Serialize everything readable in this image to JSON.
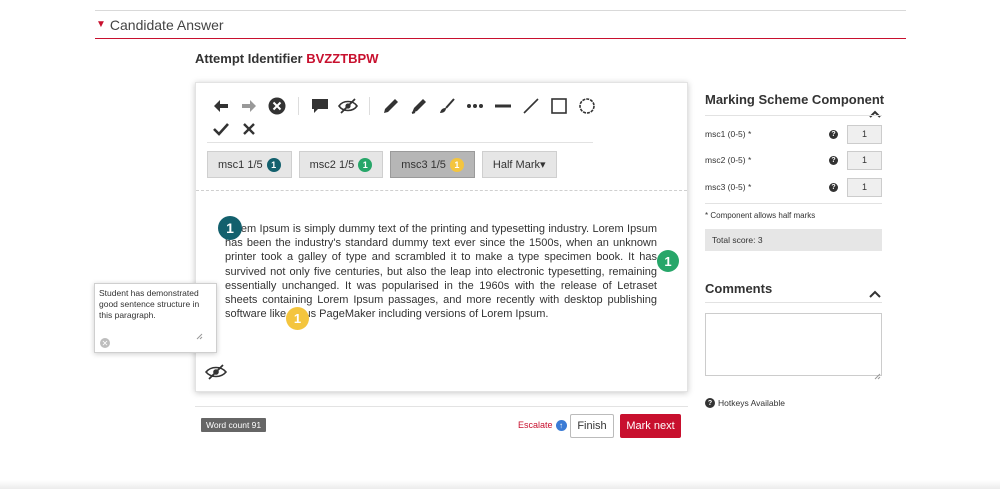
{
  "section": {
    "title": "Candidate Answer"
  },
  "attempt": {
    "label": "Attempt Identifier",
    "id": "BVZZTBPW"
  },
  "toolbar": {
    "icons": [
      "arrow-left-icon",
      "arrow-right-icon",
      "clear-circle-icon",
      "comment-icon",
      "eye-slash-icon",
      "pencil-icon",
      "marker-icon",
      "brush-icon",
      "dots-icon",
      "dash-icon",
      "line-icon",
      "rectangle-icon",
      "ellipse-icon",
      "check-icon",
      "cross-icon"
    ]
  },
  "chips": [
    {
      "label": "msc1 1/5",
      "badge": "1",
      "color": "#13606d",
      "active": false
    },
    {
      "label": "msc2 1/5",
      "badge": "1",
      "color": "#27a669",
      "active": false
    },
    {
      "label": "msc3 1/5",
      "badge": "1",
      "color": "#f4c53e",
      "active": true
    },
    {
      "label": "Half Mark▾"
    }
  ],
  "answer": {
    "text": "Lorem Ipsum is simply dummy text of the printing and typesetting industry. Lorem Ipsum has been the industry's standard dummy text ever since the 1500s, when an unknown printer took a galley of type and scrambled it to make a type specimen book. It has survived not only five centuries, but also the leap into electronic typesetting, remaining essentially unchanged. It was popularised in the 1960s with the release of Letraset sheets containing Lorem Ipsum passages, and more recently with desktop publishing software like Aldus PageMaker including versions of Lorem Ipsum.",
    "markers": [
      "1",
      "1",
      "1"
    ]
  },
  "comment_popup": {
    "text": "Student has demonstrated good sentence structure in this paragraph."
  },
  "footer": {
    "word_count": "Word count 91",
    "escalate": "Escalate",
    "finish": "Finish",
    "mark_next": "Mark next"
  },
  "marking": {
    "title": "Marking Scheme Component",
    "rows": [
      {
        "label": "msc1 (0-5) *",
        "value": "1"
      },
      {
        "label": "msc2 (0-5) *",
        "value": "1"
      },
      {
        "label": "msc3 (0-5) *",
        "value": "1"
      }
    ],
    "half_note": "* Component allows half marks",
    "total": "Total score: 3"
  },
  "comments": {
    "title": "Comments",
    "value": ""
  },
  "hotkeys": "Hotkeys Available"
}
